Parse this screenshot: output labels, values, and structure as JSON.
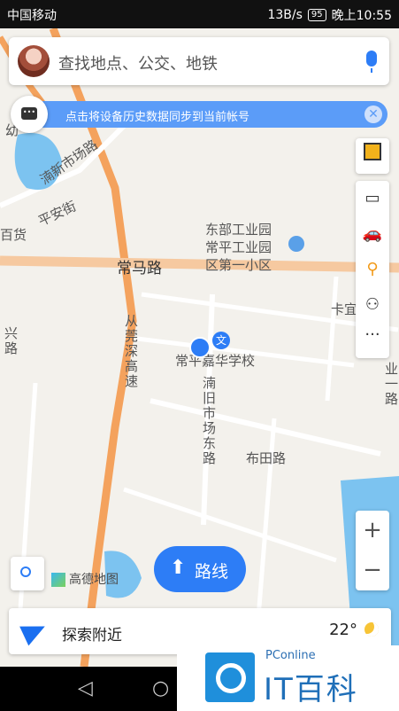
{
  "status": {
    "left": "中国移动",
    "right": "13B/s",
    "battery": "95",
    "time": "晚上10:55"
  },
  "search": {
    "placeholder": "查找地点、公交、地铁"
  },
  "sync": {
    "text": "点击将设备历史数据同步到当前帐号"
  },
  "map_labels": {
    "road_changma": "常马路",
    "road_pingan": "平安街",
    "road_jianxin": "湳新市场路",
    "road_congguan": "从莞深高速",
    "road_jiu": "湳旧市场东路",
    "road_butian": "布田路",
    "place_industry": "东部工业园",
    "place_changping": "常平工业园",
    "place_school_primary": "区第一小区",
    "place_huaxue": "常平嘉华学校",
    "edge_baihuo": "百货",
    "edge_kayi": "卡宜",
    "edge_you": "幼",
    "edge_xing": "兴路",
    "edge_ye": "业一路",
    "poi_wen": "文"
  },
  "route": {
    "label": "路线"
  },
  "logo": {
    "text": "高德地图"
  },
  "explore": {
    "label": "探索附近",
    "weather": "22°"
  },
  "watermark": {
    "small": "PConline",
    "big": "IT百科"
  },
  "colors": {
    "accent": "#2d7df6",
    "highway": "#f4a25d"
  }
}
